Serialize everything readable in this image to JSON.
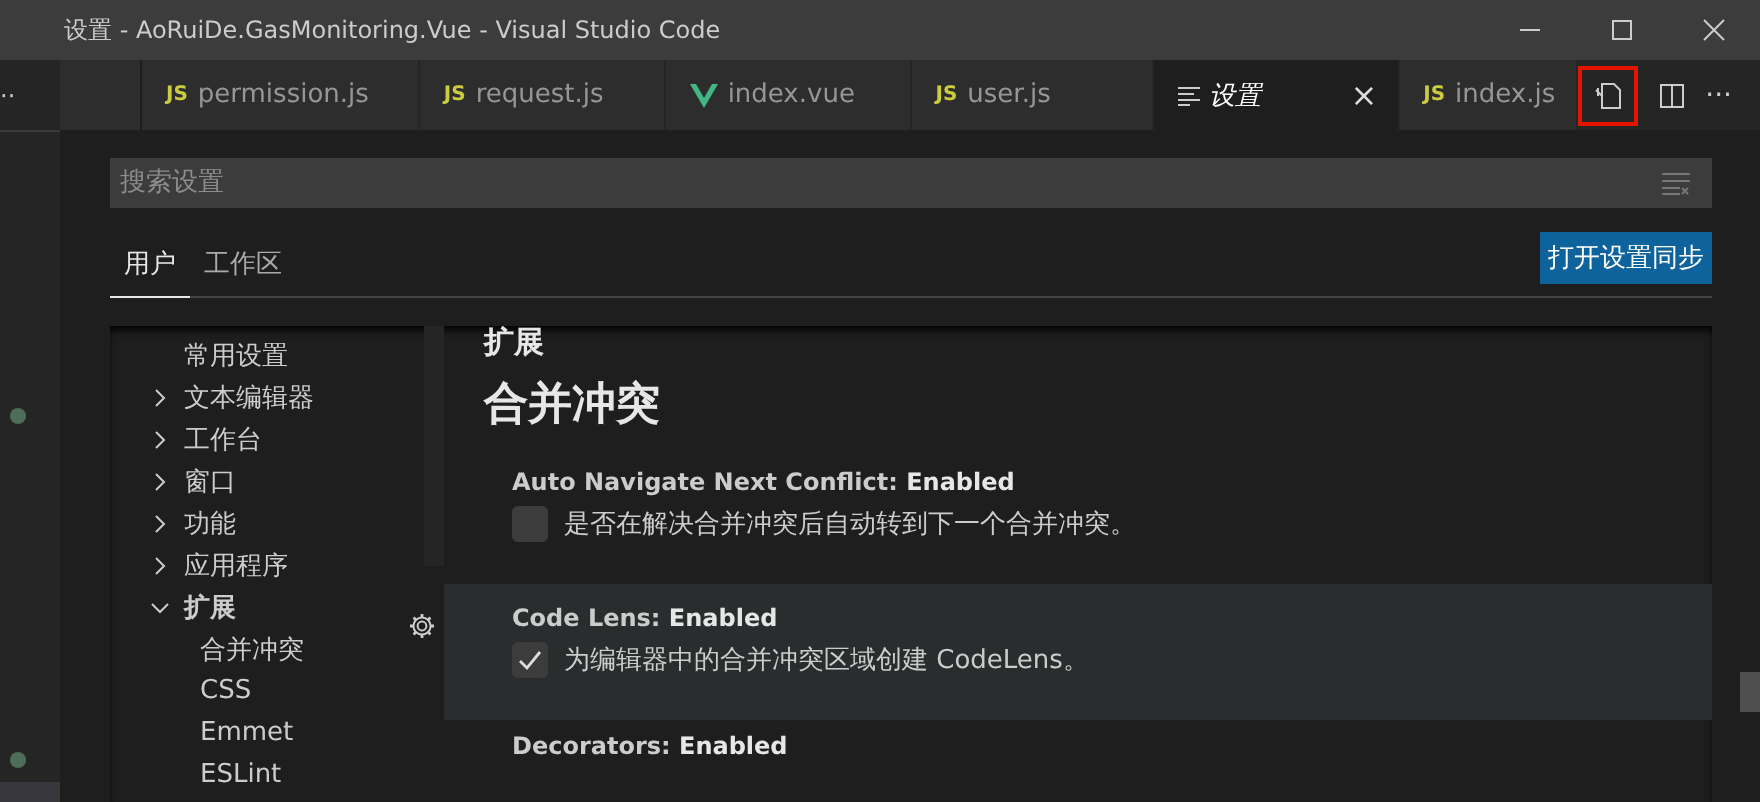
{
  "window": {
    "title": "设置 - AoRuiDe.GasMonitoring.Vue - Visual Studio Code"
  },
  "sidebar": {
    "more": "··"
  },
  "tabs": [
    {
      "label": "permission.js",
      "kind": "js",
      "icon_text": "JS",
      "selected": false
    },
    {
      "label": "request.js",
      "kind": "js",
      "icon_text": "JS",
      "selected": false
    },
    {
      "label": "index.vue",
      "kind": "vue",
      "selected": false
    },
    {
      "label": "user.js",
      "kind": "js",
      "icon_text": "JS",
      "selected": false
    },
    {
      "label": "设置",
      "kind": "settings",
      "selected": true,
      "close": "×"
    },
    {
      "label": "index.js",
      "kind": "js",
      "icon_text": "JS",
      "selected": false
    }
  ],
  "editor_actions": {
    "more": "···",
    "highlighted": true
  },
  "settings": {
    "search": {
      "placeholder": "搜索设置"
    },
    "scopes": [
      {
        "label": "用户",
        "selected": true
      },
      {
        "label": "工作区",
        "selected": false
      }
    ],
    "sync_button": "打开设置同步",
    "toc": [
      {
        "label": "常用设置"
      },
      {
        "label": "文本编辑器",
        "expanded": false
      },
      {
        "label": "工作台",
        "expanded": false
      },
      {
        "label": "窗口",
        "expanded": false
      },
      {
        "label": "功能",
        "expanded": false
      },
      {
        "label": "应用程序",
        "expanded": false
      },
      {
        "label": "扩展",
        "expanded": true,
        "children": [
          {
            "label": "合并冲突"
          },
          {
            "label": "CSS"
          },
          {
            "label": "Emmet"
          },
          {
            "label": "ESLint"
          }
        ]
      }
    ],
    "section": "扩展",
    "heading": "合并冲突",
    "items": [
      {
        "name": "Auto Navigate Next Conflict: ",
        "value": "Enabled",
        "description": "是否在解决合并冲突后自动转到下一个合并冲突。",
        "checked": false,
        "focused": false
      },
      {
        "name": "Code Lens: ",
        "value": "Enabled",
        "description": "为编辑器中的合并冲突区域创建 CodeLens。",
        "checked": true,
        "focused": true
      },
      {
        "name": "Decorators: ",
        "value": "Enabled",
        "focused": false
      }
    ]
  }
}
